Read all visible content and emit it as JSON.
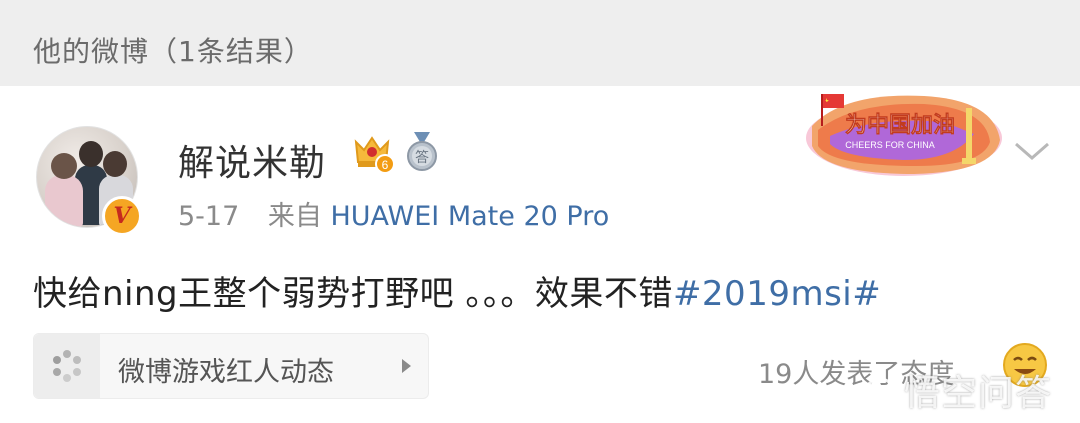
{
  "section": {
    "title": "他的微博（1条结果）"
  },
  "post": {
    "author": {
      "name": "解说米勒",
      "verified_mark": "V",
      "level_badge": "6",
      "medal_glyph": "答"
    },
    "date": "5-17",
    "source_prefix": "来自",
    "source": "HUAWEI Mate 20 Pro",
    "text": "快给ning王整个弱势打野吧 。。。效果不错",
    "hashtag": "#2019msi#",
    "banner": {
      "title": "为中国加油",
      "subtitle": "CHEERS FOR CHINA"
    },
    "topic_chip": {
      "label": "微博游戏红人动态"
    },
    "reactions_text": "19人发表了态度",
    "watermark": "悟空问答"
  },
  "colors": {
    "link": "#3f6ea6",
    "header_bg": "#eeeeee",
    "badge": "#f5a623"
  }
}
